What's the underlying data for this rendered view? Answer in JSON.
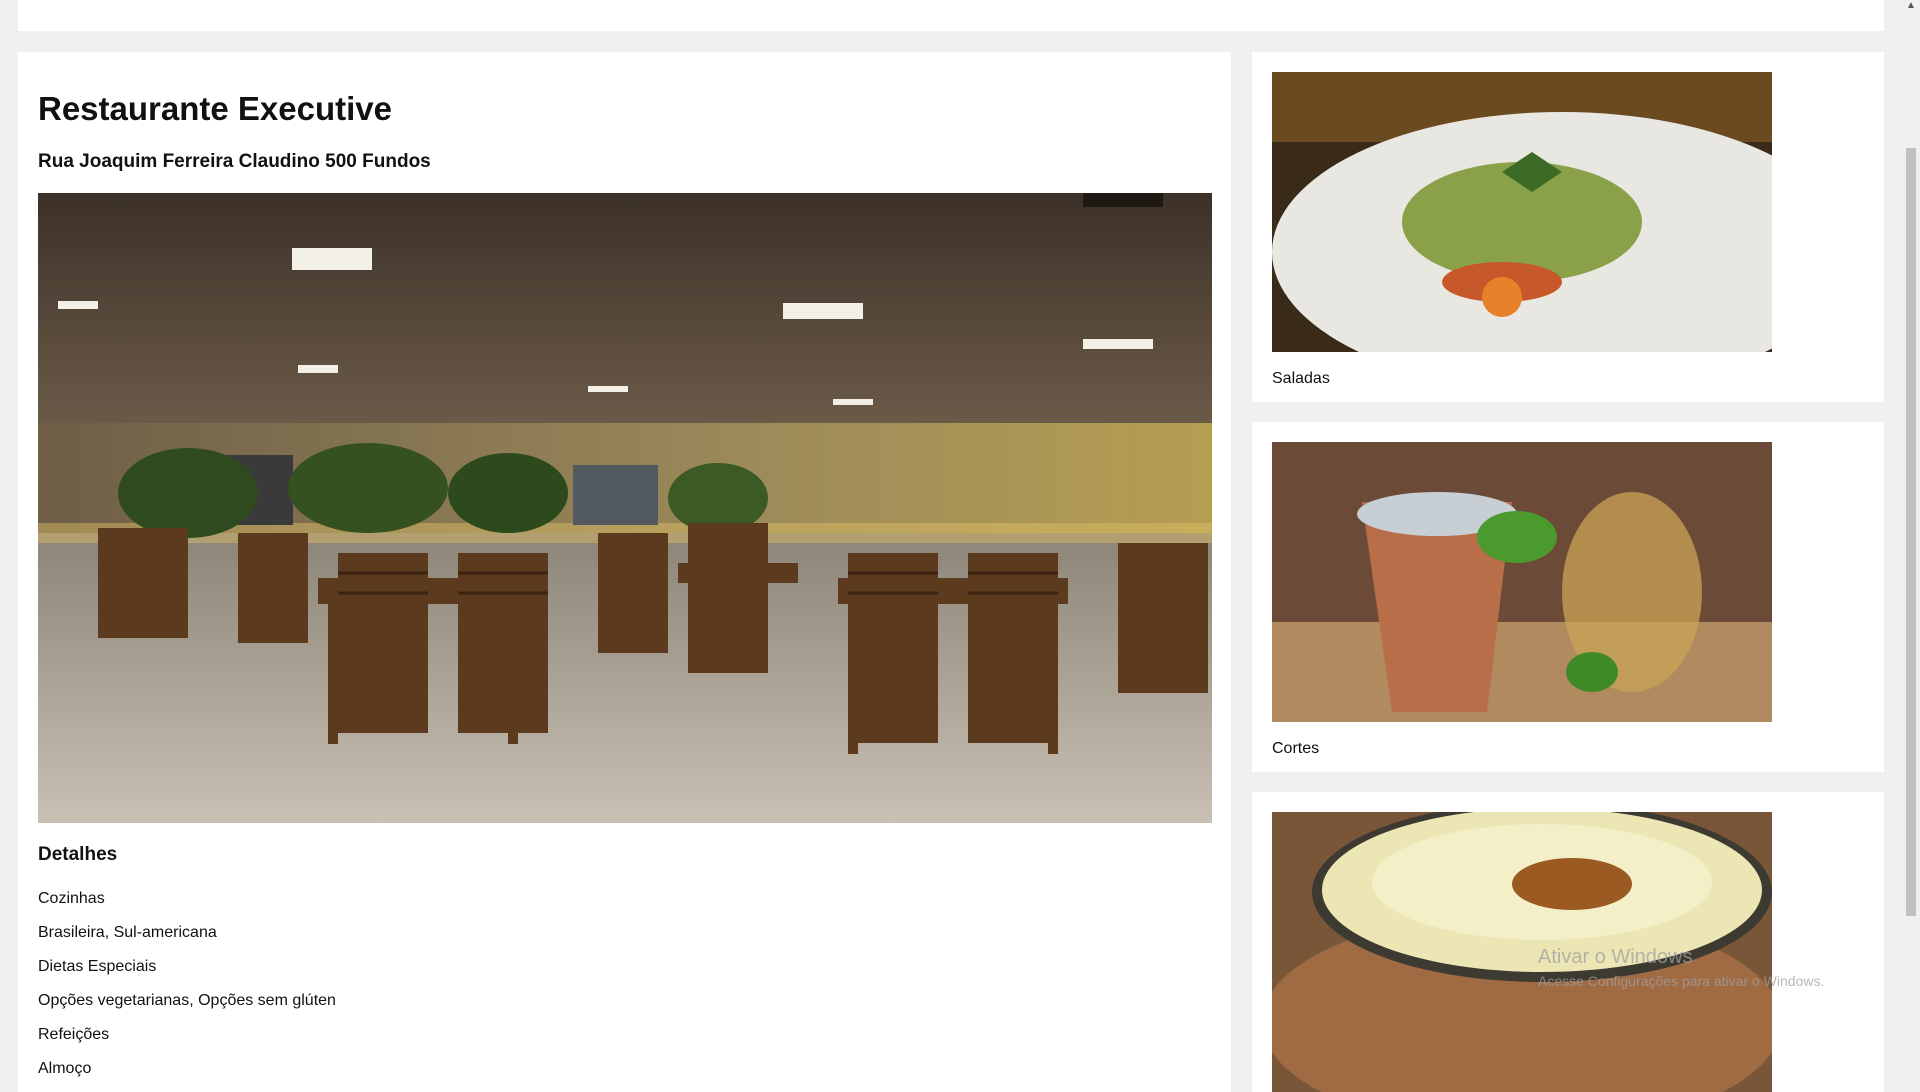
{
  "restaurant": {
    "name": "Restaurante Executive",
    "address": "Rua Joaquim Ferreira Claudino 500 Fundos"
  },
  "details": {
    "heading": "Detalhes",
    "items": [
      "Cozinhas",
      "Brasileira, Sul-americana",
      "Dietas Especiais",
      "Opções vegetarianas, Opções sem glúten",
      "Refeições",
      "Almoço"
    ]
  },
  "gallery": [
    {
      "caption": "Saladas"
    },
    {
      "caption": "Cortes"
    },
    {
      "caption": ""
    }
  ],
  "watermark": {
    "line1": "Ativar o Windows",
    "line2": "Acesse Configurações para ativar o Windows."
  },
  "colors": {
    "page_bg": "#f0f0f0",
    "card_bg": "#ffffff",
    "text": "#111111"
  }
}
